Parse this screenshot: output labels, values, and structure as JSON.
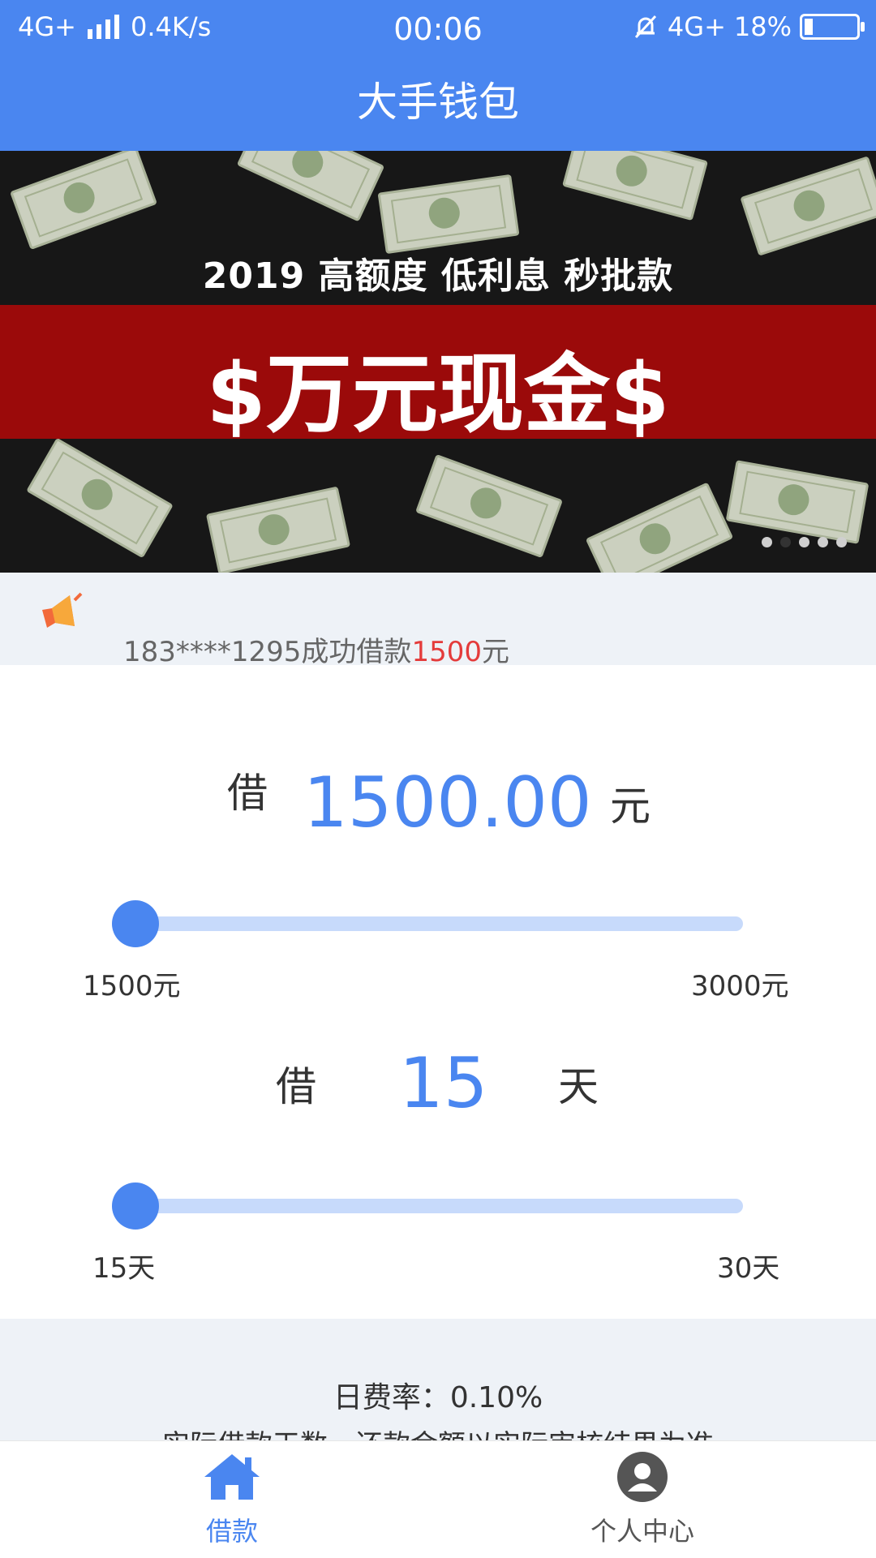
{
  "status_bar": {
    "network": "4G+",
    "speed": "0.4K/s",
    "time": "00:06",
    "network_right": "4G+",
    "battery": "18%"
  },
  "header": {
    "title": "大手钱包"
  },
  "banner": {
    "subtitle": "2019 高额度 低利息 秒批款",
    "headline": "$万元现金$",
    "page_count": 5,
    "active_page": 2
  },
  "notice": {
    "prefix": "183****1295成功借款",
    "amount": "1500",
    "suffix": "元"
  },
  "loan_amount": {
    "label": "借",
    "value": "1500.00",
    "unit": "元",
    "min_label": "1500元",
    "max_label": "3000元",
    "min": 1500,
    "max": 3000,
    "current": 1500
  },
  "loan_days": {
    "label": "借",
    "value": "15",
    "unit": "天",
    "min_label": "15天",
    "max_label": "30天",
    "min": 15,
    "max": 30,
    "current": 15
  },
  "info": {
    "rate": "日费率：0.10%",
    "note": "实际借款天数、还款金额以实际审核结果为准"
  },
  "nav": {
    "items": [
      {
        "label": "借款",
        "icon": "home-icon",
        "active": true
      },
      {
        "label": "个人中心",
        "icon": "user-icon",
        "active": false
      }
    ]
  },
  "colors": {
    "primary": "#4a86f0",
    "track": "#c7dafb",
    "highlight": "#e43b3b"
  }
}
